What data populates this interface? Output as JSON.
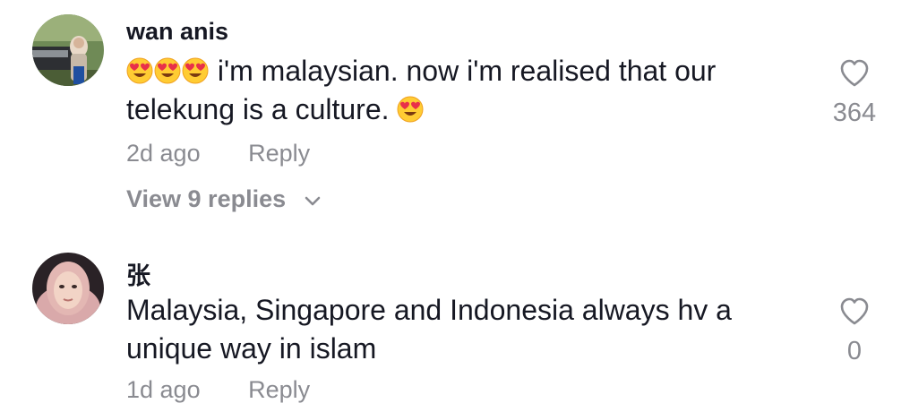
{
  "comments": [
    {
      "username": "wan anis",
      "emoji": "heart-eyes-emoji",
      "text_main": "i'm malaysian. now i'm realised that our telekung is a culture.",
      "time": "2d ago",
      "reply_label": "Reply",
      "view_replies": "View 9 replies",
      "like_count": "364"
    },
    {
      "username": "张",
      "text_main": "Malaysia, Singapore and Indonesia always hv a unique way in islam",
      "time": "1d ago",
      "reply_label": "Reply",
      "like_count": "0"
    }
  ],
  "colors": {
    "primary_text": "#161823",
    "secondary_text": "#8a8b91",
    "background": "#ffffff"
  }
}
